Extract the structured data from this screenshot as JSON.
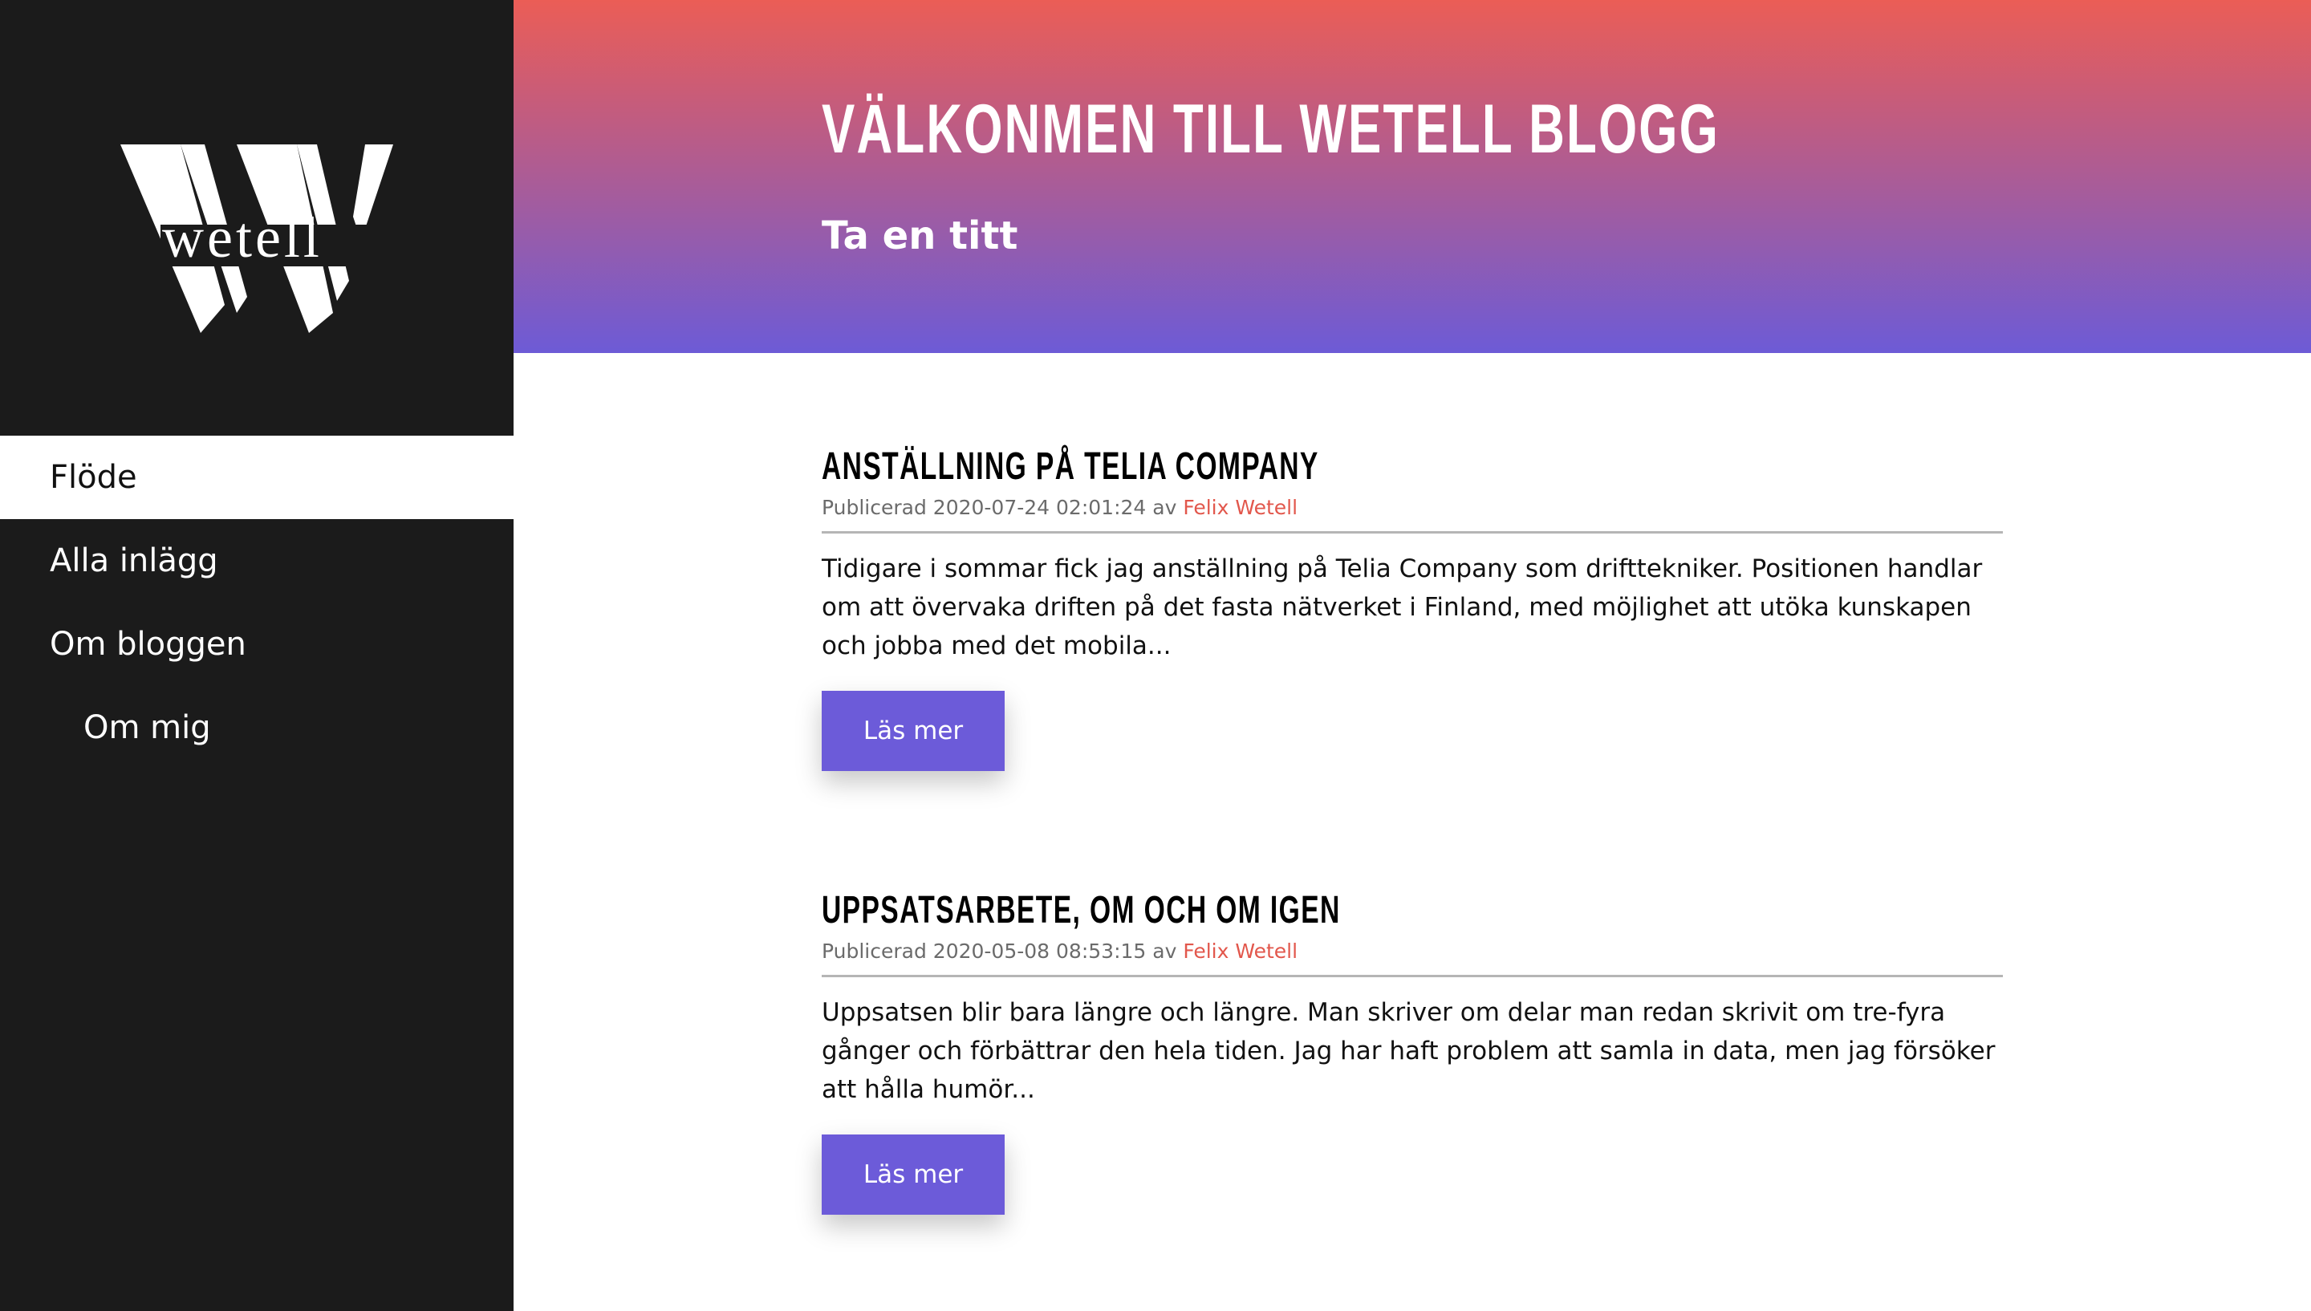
{
  "brand": {
    "logo_text": "wetell",
    "logo_letter": "W"
  },
  "sidebar": {
    "items": [
      {
        "label": "Flöde"
      },
      {
        "label": "Alla inlägg"
      },
      {
        "label": "Om bloggen"
      },
      {
        "label": "Om mig"
      }
    ]
  },
  "hero": {
    "title": "VÄLKONMEN TILL WETELL BLOGG",
    "subtitle": "Ta en titt"
  },
  "posts": [
    {
      "title": "ANSTÄLLNING PÅ TELIA COMPANY",
      "meta_prefix": "Publicerad 2020-07-24 02:01:24 av",
      "author": "Felix Wetell",
      "excerpt": "Tidigare i sommar fick jag anställning på Telia Company som drifttekniker. Positionen handlar om att övervaka driften på det fasta nätverket i Finland, med möjlighet att utöka kunskapen och jobba med det mobila...",
      "button": "Läs mer"
    },
    {
      "title": "UPPSATSARBETE, OM OCH OM IGEN",
      "meta_prefix": "Publicerad 2020-05-08 08:53:15 av",
      "author": "Felix Wetell",
      "excerpt": "Uppsatsen blir bara längre och längre. Man skriver om delar man redan skrivit om tre-fyra gånger och förbättrar den hela tiden. Jag har haft problem att samla in data, men jag försöker att hålla humör...",
      "button": "Läs mer"
    }
  ],
  "colors": {
    "sidebar": "#1b1b1b",
    "accent": "#6c5bd9",
    "author_link": "#e2574c",
    "gradient_top": "#eb5d56",
    "gradient_bottom": "#6d5bd6"
  }
}
